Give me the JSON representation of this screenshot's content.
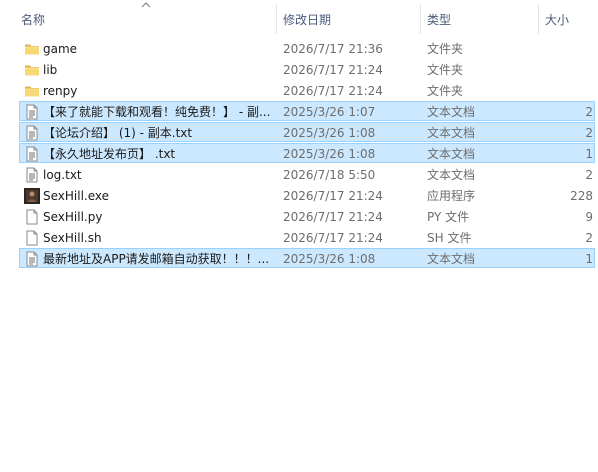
{
  "columns": {
    "name": "名称",
    "date": "修改日期",
    "type": "类型",
    "size": "大小"
  },
  "files": [
    {
      "name": "game",
      "date": "2026/7/17 21:36",
      "type": "文件夹",
      "size": "",
      "icon": "folder-icon",
      "selected": false
    },
    {
      "name": "lib",
      "date": "2026/7/17 21:24",
      "type": "文件夹",
      "size": "",
      "icon": "folder-icon",
      "selected": false
    },
    {
      "name": "renpy",
      "date": "2026/7/17 21:24",
      "type": "文件夹",
      "size": "",
      "icon": "folder-icon",
      "selected": false
    },
    {
      "name": "【来了就能下载和观看！纯免费！】 - 副...",
      "date": "2025/3/26 1:07",
      "type": "文本文档",
      "size": "2",
      "icon": "text-file-icon",
      "selected": true
    },
    {
      "name": "【论坛介绍】 (1) - 副本.txt",
      "date": "2025/3/26 1:08",
      "type": "文本文档",
      "size": "2",
      "icon": "text-file-icon",
      "selected": true
    },
    {
      "name": "【永久地址发布页】 .txt",
      "date": "2025/3/26 1:08",
      "type": "文本文档",
      "size": "1",
      "icon": "text-file-icon",
      "selected": true
    },
    {
      "name": "log.txt",
      "date": "2026/7/18 5:50",
      "type": "文本文档",
      "size": "2",
      "icon": "text-file-icon",
      "selected": false
    },
    {
      "name": "SexHill.exe",
      "date": "2026/7/17 21:24",
      "type": "应用程序",
      "size": "228",
      "icon": "application-icon",
      "selected": false
    },
    {
      "name": "SexHill.py",
      "date": "2026/7/17 21:24",
      "type": "PY 文件",
      "size": "9",
      "icon": "blank-file-icon",
      "selected": false
    },
    {
      "name": "SexHill.sh",
      "date": "2026/7/17 21:24",
      "type": "SH 文件",
      "size": "2",
      "icon": "blank-file-icon",
      "selected": false
    },
    {
      "name": "最新地址及APP请发邮箱自动获取！！！...",
      "date": "2025/3/26 1:08",
      "type": "文本文档",
      "size": "1",
      "icon": "text-file-icon",
      "selected": true
    }
  ]
}
